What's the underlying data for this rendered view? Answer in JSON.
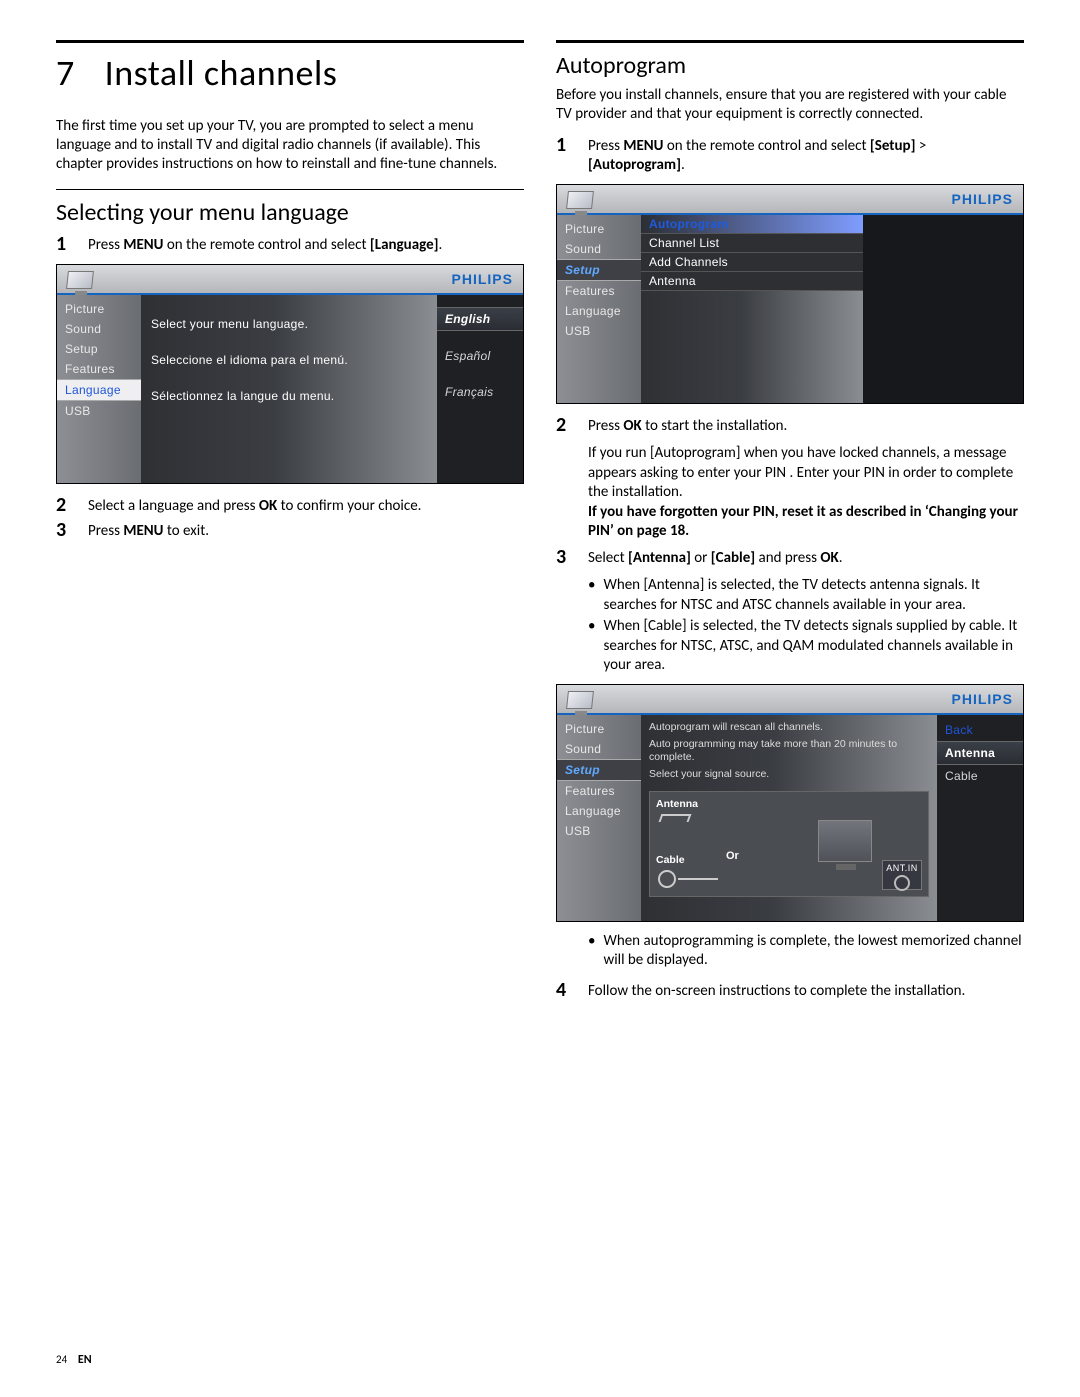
{
  "chapter": {
    "num": "7",
    "title": "Install channels"
  },
  "left": {
    "intro": "The first time you set up your TV, you are prompted to select a menu language and to install TV and digital radio channels (if available). This chapter provides instructions on how to reinstall and fine-tune channels.",
    "section": "Selecting your menu language",
    "steps": {
      "s1_a": "Press ",
      "s1_b1": "MENU",
      "s1_c": " on the remote control and select ",
      "s1_b2": "[Language]",
      "s1_d": ".",
      "s2_a": "Select a language and press ",
      "s2_b1": "OK",
      "s2_c": " to confirm your choice.",
      "s3_a": "Press ",
      "s3_b1": "MENU",
      "s3_c": " to exit."
    },
    "tv": {
      "brand": "PHILIPS",
      "side": [
        "Picture",
        "Sound",
        "Setup",
        "Features",
        "Language",
        "USB"
      ],
      "side_active_index": 4,
      "prompts": [
        "Select your menu language.",
        "Seleccione el idioma para el menú.",
        "Sélectionnez la langue du menu."
      ],
      "options": [
        "English",
        "Español",
        "Français"
      ],
      "option_selected_index": 0
    }
  },
  "right": {
    "section": "Autoprogram",
    "intro": "Before you install channels, ensure that you are registered with your cable TV provider and that your equipment is correctly connected.",
    "steps": {
      "s1_a": "Press ",
      "s1_b1": "MENU",
      "s1_c": " on the remote control and select ",
      "s1_b2": "[Setup]",
      "s1_d": " > ",
      "s1_b3": "[Autoprogram]",
      "s1_e": ".",
      "s2_a": "Press ",
      "s2_b1": "OK",
      "s2_c": " to start the installation.",
      "s2_note1_a": "If you run ",
      "s2_note1_b1": "[Autoprogram]",
      "s2_note1_c": " when you have locked channels, a message appears asking to enter your ",
      "s2_note1_b2": "PIN",
      "s2_note1_d": " . Enter your ",
      "s2_note1_b3": "PIN",
      "s2_note1_e": " in order to complete the installation.",
      "s2_note2": "If you have forgotten your PIN, reset it as described in ‘Changing your PIN’ on page 18.",
      "s3_a": "Select ",
      "s3_b1": "[Antenna]",
      "s3_c": " or ",
      "s3_b2": "[Cable]",
      "s3_d": " and press ",
      "s3_b3": "OK",
      "s3_e": ".",
      "s3_bullet1_a": "When ",
      "s3_bullet1_b": "[Antenna]",
      "s3_bullet1_c": " is selected, the TV detects antenna signals. It searches for NTSC and ATSC channels available in your area.",
      "s3_bullet2_a": "When ",
      "s3_bullet2_b": "[Cable]",
      "s3_bullet2_c": " is selected, the TV detects signals supplied by cable. It searches for NTSC, ATSC, and QAM modulated channels available in your area.",
      "s3_bullet3": "When autoprogramming is complete, the lowest memorized channel will be displayed.",
      "s4": "Follow the on-screen instructions to complete the installation."
    },
    "tv1": {
      "brand": "PHILIPS",
      "side": [
        "Picture",
        "Sound",
        "Setup",
        "Features",
        "Language",
        "USB"
      ],
      "side_selected_index": 2,
      "submenu": [
        "Autoprogram",
        "Channel List",
        "Add Channels",
        "Antenna"
      ],
      "submenu_active_index": 0
    },
    "tv2": {
      "brand": "PHILIPS",
      "side": [
        "Picture",
        "Sound",
        "Setup",
        "Features",
        "Language",
        "USB"
      ],
      "side_selected_index": 2,
      "info": [
        "Autoprogram will rescan all channels.",
        "Auto programming  may take more than 20 minutes to complete.",
        "Select your signal source."
      ],
      "conn": {
        "antenna": "Antenna",
        "cable": "Cable",
        "or": "Or",
        "antin": "ANT.IN"
      },
      "right_options": [
        "Back",
        "Antenna",
        "Cable"
      ],
      "right_blue_index": 0,
      "right_selected_index": 1
    }
  },
  "footer": {
    "page": "24",
    "lang": "EN"
  }
}
